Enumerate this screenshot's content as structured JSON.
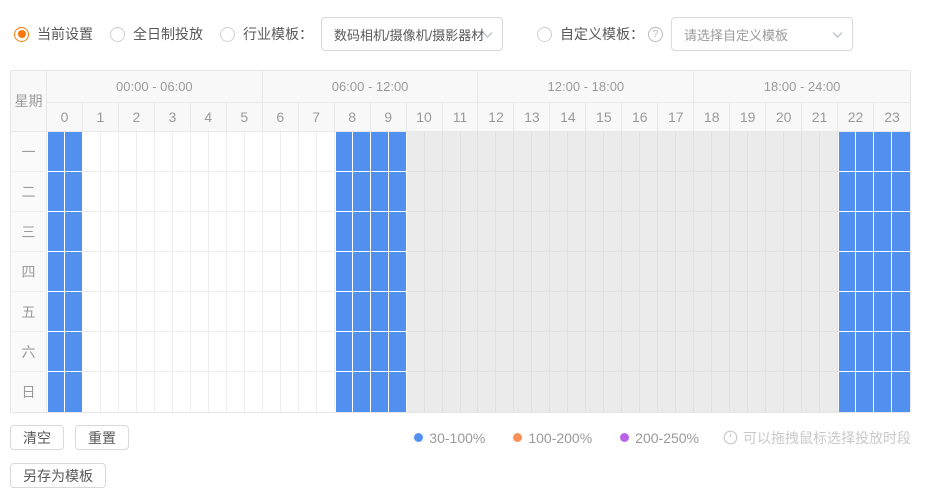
{
  "toolbar": {
    "radio_current": "当前设置",
    "radio_allday": "全日制投放",
    "radio_industry": "行业模板：",
    "industry_template_value": "数码相机/摄像机/摄影器材",
    "radio_custom": "自定义模板：",
    "help_mark": "?",
    "custom_template_placeholder": "请选择自定义模板"
  },
  "schedule": {
    "corner_label": "星期",
    "time_groups": [
      "00:00 - 06:00",
      "06:00 - 12:00",
      "12:00 - 18:00",
      "18:00 - 24:00"
    ],
    "hours": [
      "0",
      "1",
      "2",
      "3",
      "4",
      "5",
      "6",
      "7",
      "8",
      "9",
      "10",
      "11",
      "12",
      "13",
      "14",
      "15",
      "16",
      "17",
      "18",
      "19",
      "20",
      "21",
      "22",
      "23"
    ],
    "days": [
      "一",
      "二",
      "三",
      "四",
      "五",
      "六",
      "日"
    ],
    "selection": {
      "applies_to_all_days": true,
      "selected_hours": [
        0,
        8,
        9,
        22,
        23
      ],
      "selected_level": "30-100%",
      "muted_hours": [
        10,
        11,
        12,
        13,
        14,
        15,
        16,
        17,
        18,
        19,
        20,
        21
      ]
    }
  },
  "footer": {
    "clear_label": "清空",
    "reset_label": "重置",
    "save_template_label": "另存为模板",
    "legend": [
      {
        "label": "30-100%",
        "color": "#5291f0"
      },
      {
        "label": "100-200%",
        "color": "#fa9057"
      },
      {
        "label": "200-250%",
        "color": "#bb63e8"
      }
    ],
    "hint": "可以拖拽鼠标选择投放时段"
  },
  "colors": {
    "accent_orange": "#f87a0d",
    "cell_blue": "#5190ef",
    "cell_muted": "#ebebeb"
  }
}
